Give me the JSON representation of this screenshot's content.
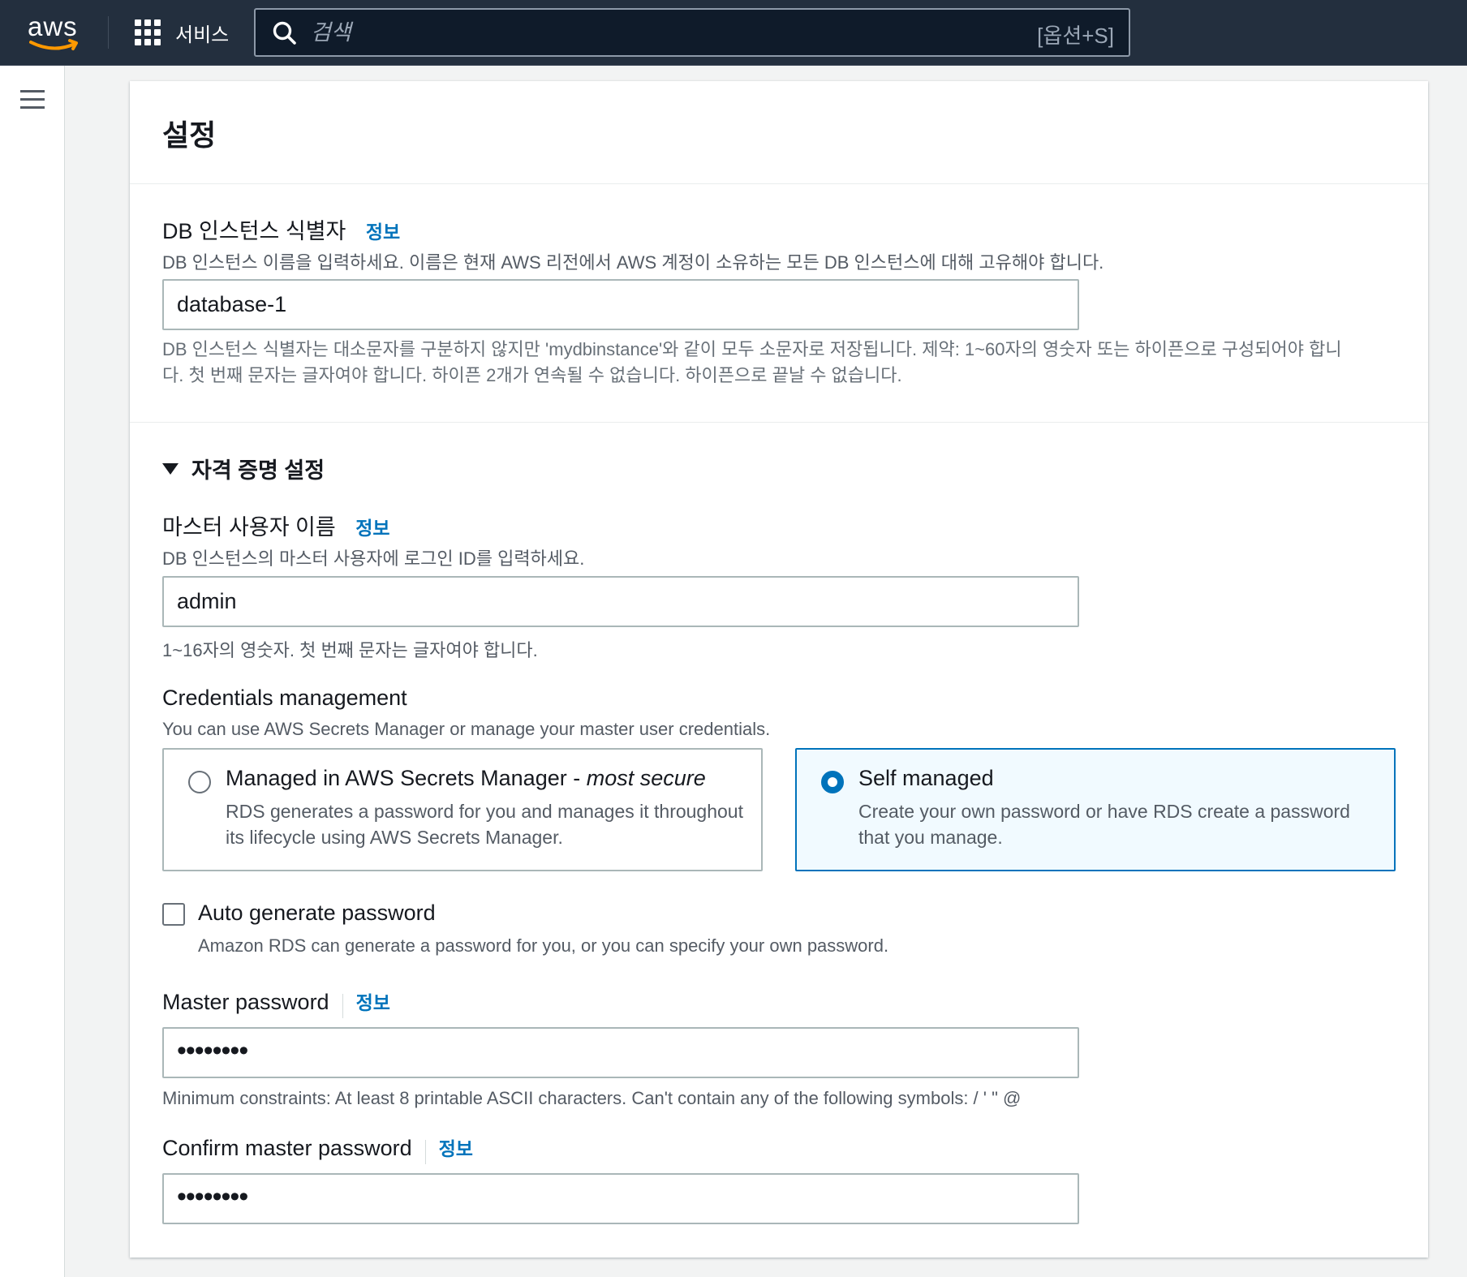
{
  "topnav": {
    "logo_text": "aws",
    "services_label": "서비스",
    "search_placeholder": "검색",
    "search_shortcut": "[옵션+S]"
  },
  "panel": {
    "title": "설정"
  },
  "db_identifier": {
    "label": "DB 인스턴스 식별자",
    "info": "정보",
    "description": "DB 인스턴스 이름을 입력하세요. 이름은 현재 AWS 리전에서 AWS 계정이 소유하는 모든 DB 인스턴스에 대해 고유해야 합니다.",
    "value": "database-1",
    "hint_line1": "DB 인스턴스 식별자는 대소문자를 구분하지 않지만 'mydbinstance'와 같이 모두 소문자로 저장됩니다. 제약: 1~60자의 영숫자 또는 하이픈으로 구성되어야 합니",
    "hint_line2": "다. 첫 번째 문자는 글자여야 합니다. 하이픈 2개가 연속될 수 없습니다. 하이픈으로 끝날 수 없습니다."
  },
  "credentials_section": {
    "title": "자격 증명 설정"
  },
  "master_username": {
    "label": "마스터 사용자 이름",
    "info": "정보",
    "description": "DB 인스턴스의 마스터 사용자에 로그인 ID를 입력하세요.",
    "value": "admin",
    "hint": "1~16자의 영숫자. 첫 번째 문자는 글자여야 합니다."
  },
  "credentials_management": {
    "label": "Credentials management",
    "description": "You can use AWS Secrets Manager or manage your master user credentials.",
    "options": [
      {
        "title": "Managed in AWS Secrets Manager - ",
        "title_emphasis": "most secure",
        "description": "RDS generates a password for you and manages it throughout its lifecycle using AWS Secrets Manager.",
        "selected": false
      },
      {
        "title": "Self managed",
        "description": "Create your own password or have RDS create a password that you manage.",
        "selected": true
      }
    ]
  },
  "auto_generate": {
    "label": "Auto generate password",
    "description": "Amazon RDS can generate a password for you, or you can specify your own password.",
    "checked": false
  },
  "master_password": {
    "label": "Master password",
    "info": "정보",
    "value": "••••••••",
    "hint": "Minimum constraints: At least 8 printable ASCII characters. Can't contain any of the following symbols: / ' \" @"
  },
  "confirm_password": {
    "label": "Confirm master password",
    "info": "정보",
    "value": "••••••••"
  },
  "colors": {
    "nav_bg": "#232f3e",
    "link": "#0073bb",
    "selected_tile_bg": "#f1faff",
    "logo_smile": "#ff9900"
  }
}
